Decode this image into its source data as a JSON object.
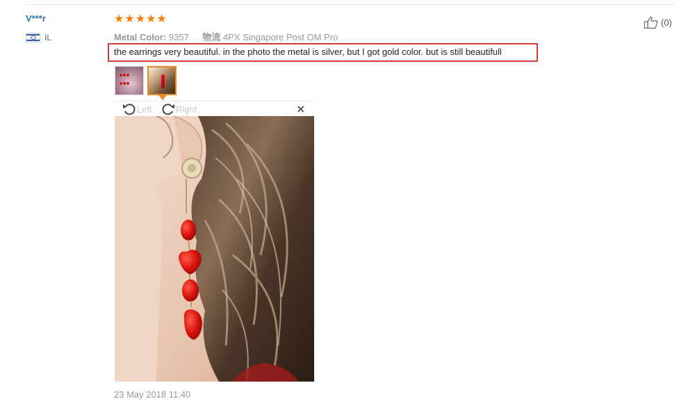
{
  "review": {
    "user_name": "V***r",
    "country": "IL",
    "rating_stars": 5,
    "stars": [
      "★",
      "★",
      "★",
      "★",
      "★"
    ],
    "metal_color_label": "Metal Color:",
    "metal_color_value": "9357",
    "shipping_label": "物流",
    "shipping_value": "4PX Singapore Post OM Pro",
    "text": "the earrings very beautiful. in the photo the metal is silver, but I got gold color. but is still beautifull",
    "date": "23 May 2018 11:40",
    "likes": "(0)"
  },
  "viewer": {
    "rotate_left_label": "Left",
    "rotate_right_label": "Right",
    "close_symbol": "×"
  },
  "colors": {
    "accent": "#ff7a00",
    "username": "#2a6fb8",
    "highlight_border": "#d43a3a",
    "thumb_selected_border": "#e58b2a"
  },
  "icons": {
    "like": "thumbs-up-icon",
    "rotate_left": "rotate-left-icon",
    "rotate_right": "rotate-right-icon",
    "close": "close-icon",
    "flag": "flag-icon",
    "star": "star-icon"
  }
}
